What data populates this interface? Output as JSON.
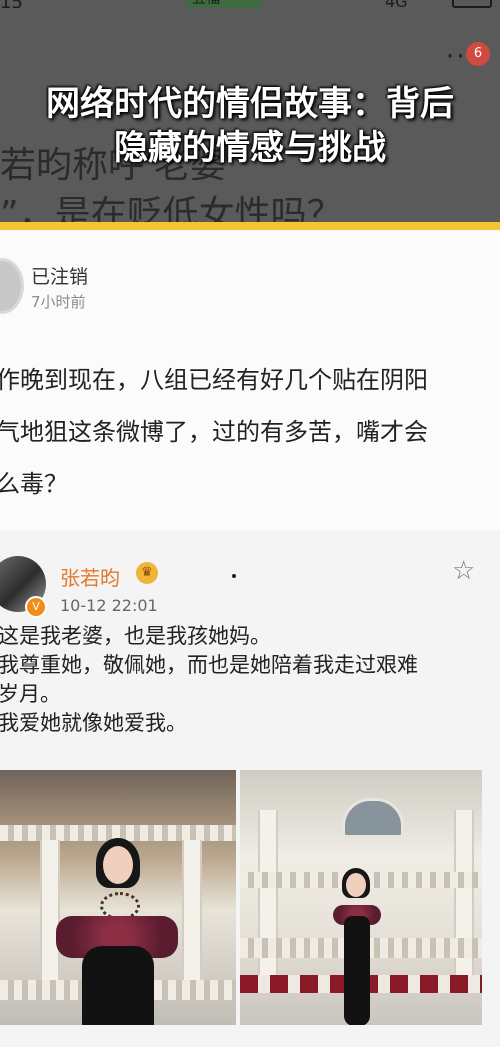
{
  "status_bar": {
    "time": "15",
    "app_label": "五福",
    "network": "4G"
  },
  "header": {
    "more_icon": "more-icon",
    "badge_count": "6",
    "bg_line_1": "若昀称呼'老婆'",
    "bg_line_2": "”，是在贬低女性吗？",
    "title": "网络时代的情侣故事：背后\n隐藏的情感与挑战"
  },
  "post": {
    "username": "已注销",
    "time": "7小时前",
    "text": "作晚到现在，八组已经有好几个贴在阴阳\n气地狙这条微博了，过的有多苦，嘴才会\n么毒？"
  },
  "repost": {
    "username": "张若昀",
    "time": "10-12 22:01",
    "v_badge": "V",
    "text": "这是我老婆，也是我孩她妈。\n我尊重她，敬佩她，而也是她陪着我走过艰难\n岁月。\n我爱她就像她爱我。",
    "star_icon": "star-icon"
  },
  "colors": {
    "accent_orange": "#e07a2c",
    "yellow_bar": "#f3c433",
    "badge_red": "#d04a3f"
  }
}
